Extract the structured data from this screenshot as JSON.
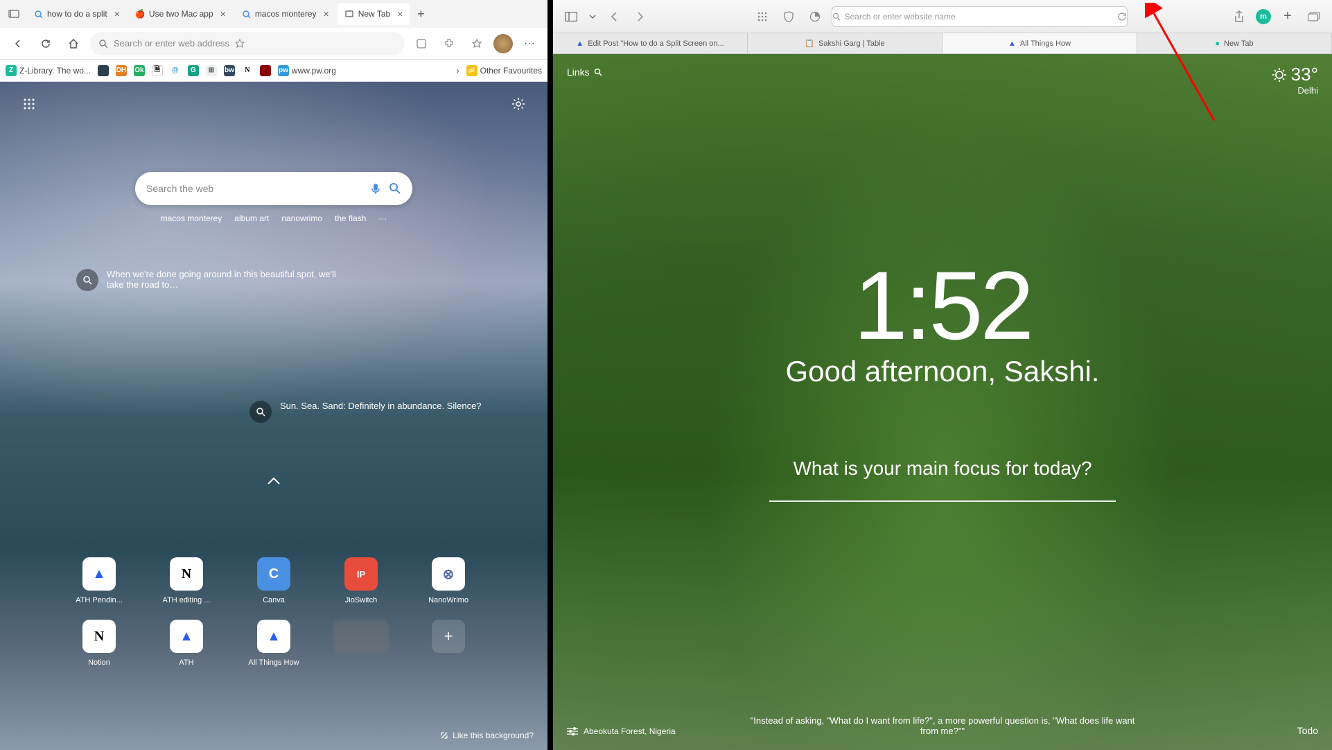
{
  "edge": {
    "tabs": [
      {
        "label": "how to do a split",
        "icon_bg": "#4a90e2"
      },
      {
        "label": "Use two Mac app",
        "icon_bg": "#888"
      },
      {
        "label": "macos monterey",
        "icon_bg": "#4a90e2"
      },
      {
        "label": "New Tab",
        "icon_bg": "#555",
        "active": true
      }
    ],
    "address_placeholder": "Search or enter web address",
    "bookmarks": [
      {
        "label": "Z-Library. The wo...",
        "bg": "#1abc9c"
      },
      {
        "label": "",
        "bg": "#2c3e50"
      },
      {
        "label": "",
        "bg": "#e74c3c"
      },
      {
        "label": "",
        "bg": "#27ae60"
      },
      {
        "label": "",
        "bg": "#fff"
      },
      {
        "label": "",
        "bg": "#3498db"
      },
      {
        "label": "",
        "bg": "#16a085"
      },
      {
        "label": "",
        "bg": "#ecf0f1"
      },
      {
        "label": "",
        "bg": "#34495e"
      },
      {
        "label": "",
        "bg": "#000",
        "text": "N"
      },
      {
        "label": "",
        "bg": "#8b0000"
      },
      {
        "label": "www.pw.org",
        "bg": "#3498db"
      }
    ],
    "other_favorites": "Other Favourites",
    "search_placeholder": "Search the web",
    "trending": [
      "macos monterey",
      "album art",
      "nanowrimo",
      "the flash",
      "···"
    ],
    "news1": "When we're done going around in this beautiful spot, we'll take the road to…",
    "news2": "Sun. Sea. Sand: Definitely in abundance. Silence?",
    "quick_links_row1": [
      {
        "label": "ATH Pendin...",
        "icon": "▲",
        "bg": "#fff",
        "color": "#2b5ce8"
      },
      {
        "label": "ATH editing ...",
        "icon": "N",
        "bg": "#fff",
        "color": "#000"
      },
      {
        "label": "Canva",
        "icon": "C",
        "bg": "#4a90e2",
        "color": "#fff"
      },
      {
        "label": "JioSwitch",
        "icon": "IP",
        "bg": "#e74c3c",
        "color": "#fff"
      },
      {
        "label": "NanoWrimo",
        "icon": "⊗",
        "bg": "#fff",
        "color": "#5b6ea8"
      }
    ],
    "quick_links_row2": [
      {
        "label": "Notion",
        "icon": "N",
        "bg": "#fff",
        "color": "#000"
      },
      {
        "label": "ATH",
        "icon": "▲",
        "bg": "#fff",
        "color": "#2b5ce8"
      },
      {
        "label": "All Things How",
        "icon": "▲",
        "bg": "#fff",
        "color": "#2b5ce8"
      }
    ],
    "like_bg": "Like this background?"
  },
  "safari": {
    "address_placeholder": "Search or enter website name",
    "avatar_letter": "m",
    "tabs": [
      {
        "label": "Edit Post \"How to do a Split Screen on...",
        "icon": "▲"
      },
      {
        "label": "Sakshi Garg | Table",
        "icon": "N"
      },
      {
        "label": "All Things How",
        "icon": "▲",
        "active": true
      },
      {
        "label": "New Tab",
        "icon": "●"
      }
    ],
    "links_label": "Links",
    "weather_temp": "33°",
    "weather_loc": "Delhi",
    "clock": "1:52",
    "greeting": "Good afternoon, Sakshi.",
    "focus_label": "What is your main focus for today?",
    "quote": "\"Instead of asking, \"What do I want from life?\", a more powerful question is, \"What does life want from me?\"\"",
    "location": "Abeokuta Forest, Nigeria",
    "todo": "Todo"
  }
}
